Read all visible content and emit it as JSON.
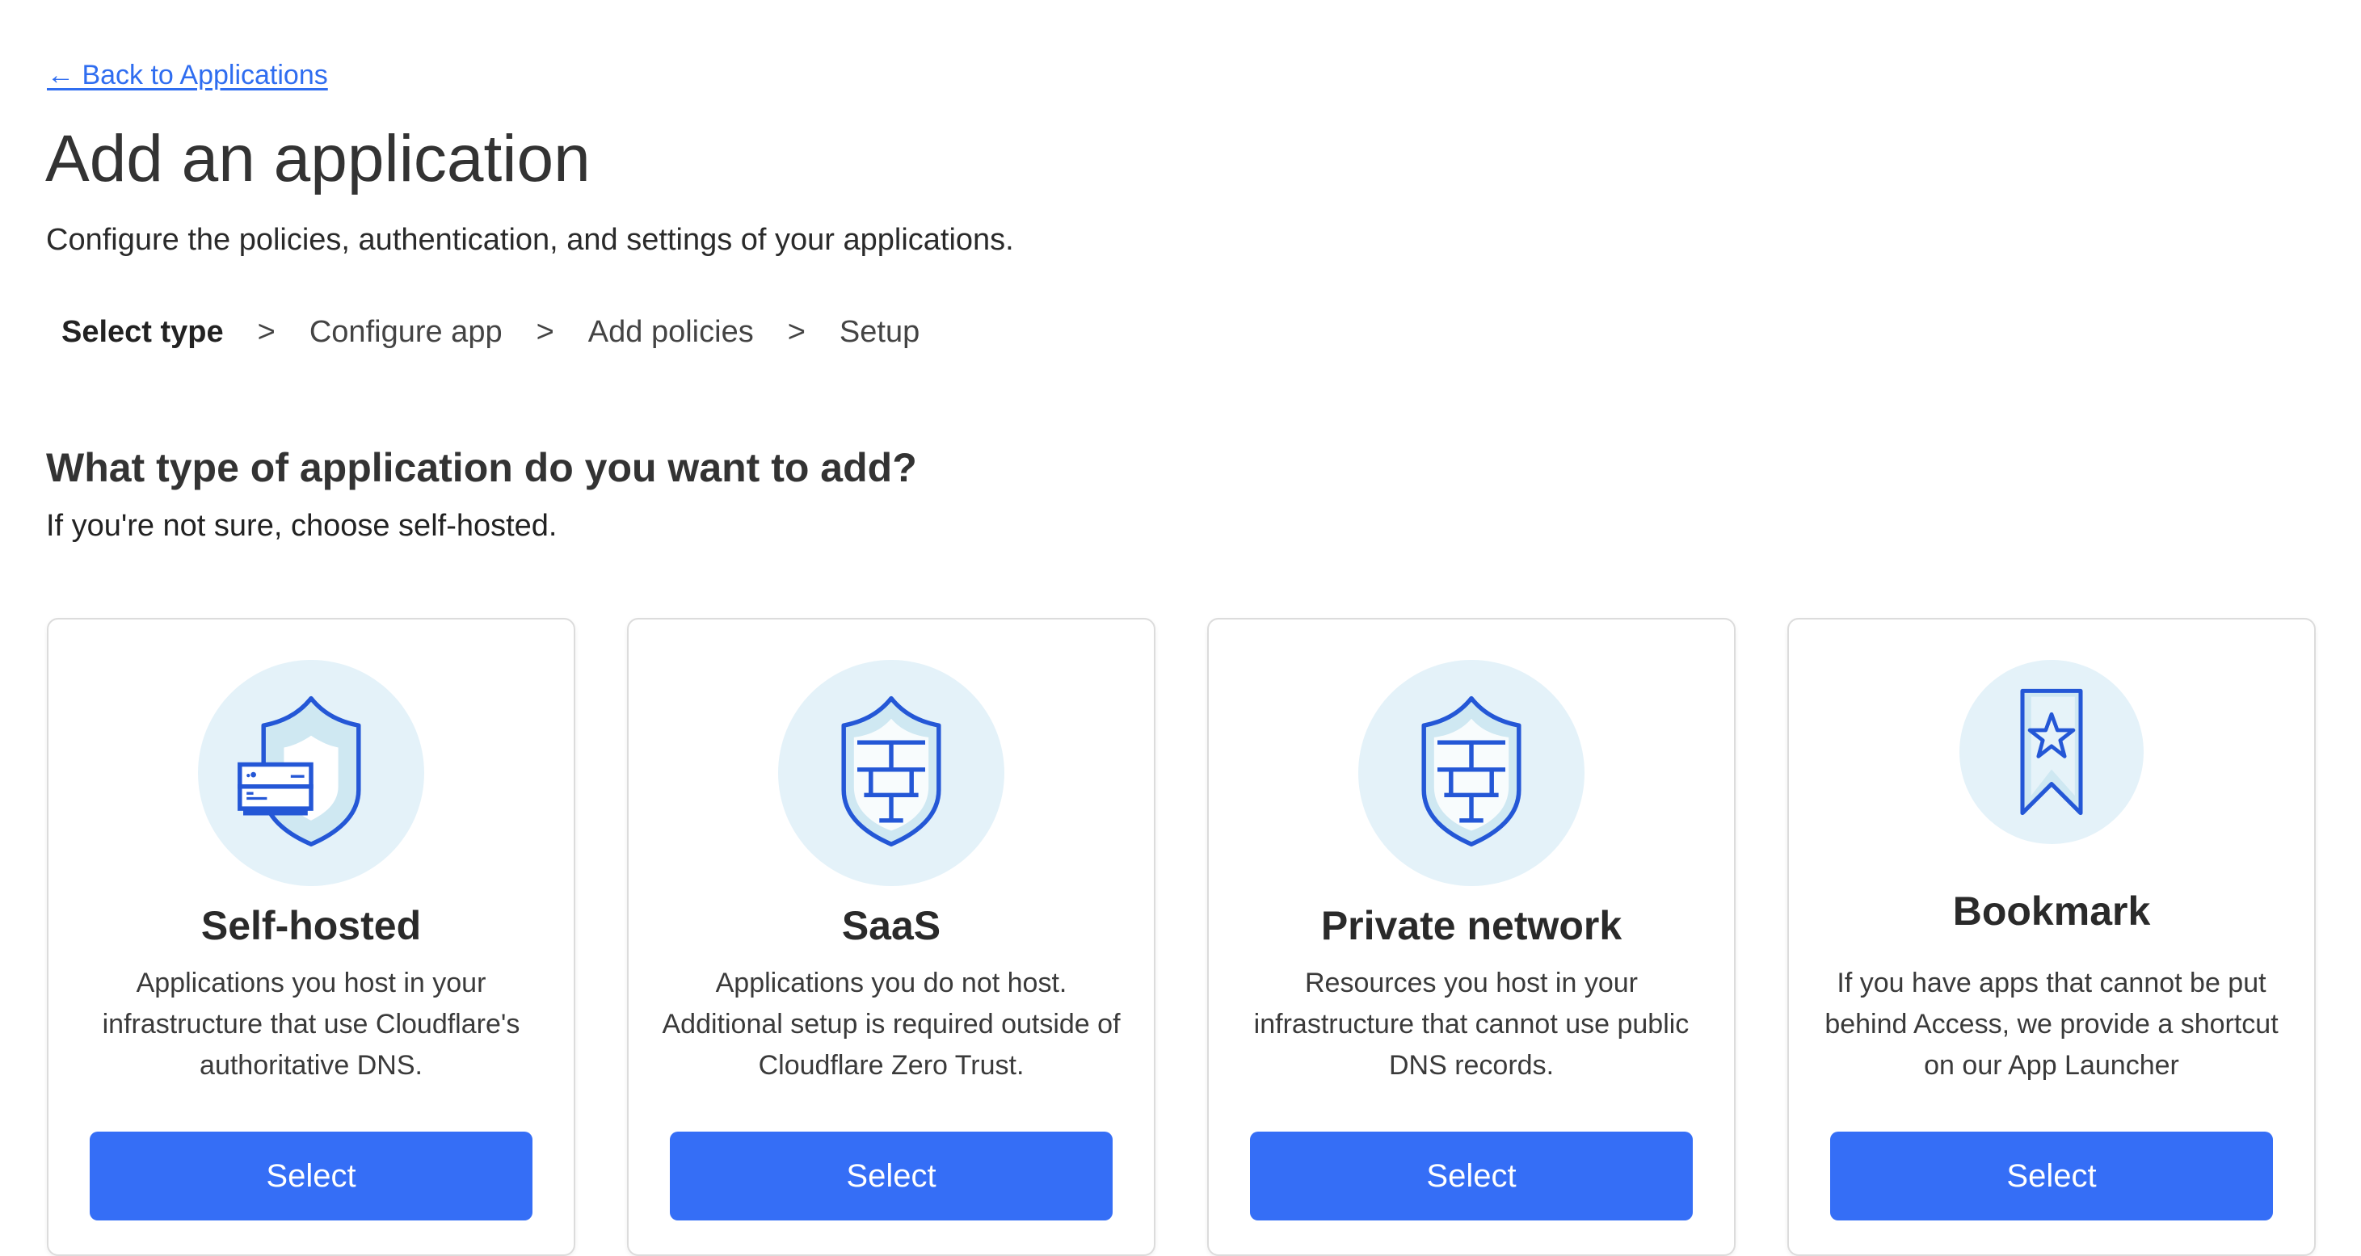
{
  "nav": {
    "back_link": "← Back to Applications"
  },
  "header": {
    "title": "Add an application",
    "subtitle": "Configure the policies, authentication, and settings of your applications."
  },
  "steps": [
    {
      "label": "Select type",
      "active": true
    },
    {
      "label": "Configure app",
      "active": false
    },
    {
      "label": "Add policies",
      "active": false
    },
    {
      "label": "Setup",
      "active": false
    }
  ],
  "step_separator": ">",
  "section": {
    "question": "What type of application do you want to add?",
    "hint": "If you're not sure, choose self-hosted."
  },
  "cards": [
    {
      "icon": "shield-server-icon",
      "title": "Self-hosted",
      "description": "Applications you host in your infrastructure that use Cloudflare's authoritative DNS.",
      "button": "Select"
    },
    {
      "icon": "shield-firewall-icon",
      "title": "SaaS",
      "description": "Applications you do not host. Additional setup is required outside of Cloudflare Zero Trust.",
      "button": "Select"
    },
    {
      "icon": "shield-firewall-icon",
      "title": "Private network",
      "description": "Resources you host in your infrastructure that cannot use public DNS records.",
      "button": "Select"
    },
    {
      "icon": "bookmark-star-icon",
      "title": "Bookmark",
      "description": "If you have apps that cannot be put behind Access, we provide a shortcut on our App Launcher",
      "button": "Select"
    }
  ],
  "colors": {
    "accent": "#356ef6",
    "link": "#2f6df0",
    "icon_stroke": "#2457d6",
    "icon_bg": "#e4f2f9"
  }
}
